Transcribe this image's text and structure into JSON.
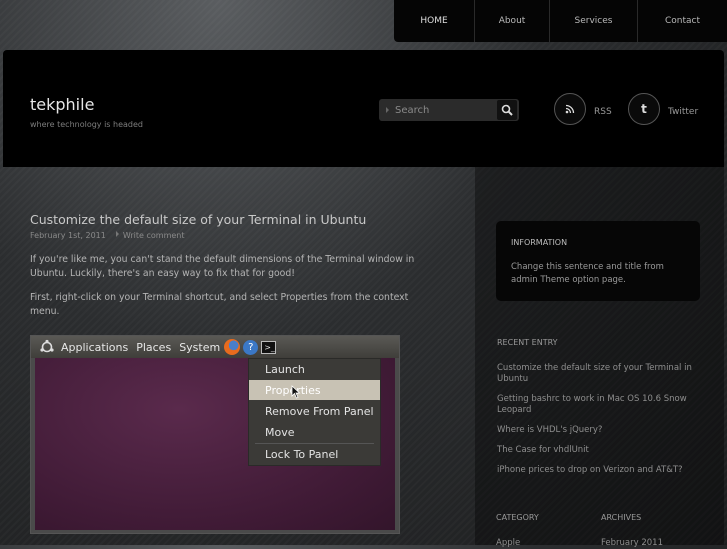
{
  "nav": {
    "items": [
      "HOME",
      "About",
      "Services",
      "Contact"
    ]
  },
  "header": {
    "title": "tekphile",
    "tagline": "where technology is headed",
    "search_placeholder": "Search",
    "rss_label": "RSS",
    "twitter_label": "Twitter"
  },
  "post": {
    "title": "Customize the default size of your Terminal in Ubuntu",
    "date": "February 1st, 2011",
    "comment_link": "Write comment",
    "para1": "If you're like me, you can't stand the default dimensions of the Terminal window in Ubuntu. Luckily, there's an easy way to fix that for good!",
    "para2": "First, right-click on your Terminal shortcut, and select Properties from the context menu."
  },
  "screenshot": {
    "panel_menus": [
      "Applications",
      "Places",
      "System"
    ],
    "context_menu": [
      "Launch",
      "Properties",
      "Remove From Panel",
      "Move",
      "Lock To Panel"
    ],
    "highlighted_index": 1
  },
  "sidebar": {
    "info_title": "INFORMATION",
    "info_text": "Change this sentence and title from admin Theme option page.",
    "recent_heading": "RECENT ENTRY",
    "recent": [
      "Customize the default size of your Terminal in Ubuntu",
      "Getting bashrc to work in Mac OS 10.6 Snow Leopard",
      "Where is VHDL's jQuery?",
      "The Case for vhdlUnit",
      "iPhone prices to drop on Verizon and AT&T?"
    ],
    "category_heading": "CATEGORY",
    "archives_heading": "ARCHIVES",
    "category_first": "Apple",
    "archives_first": "February 2011"
  }
}
